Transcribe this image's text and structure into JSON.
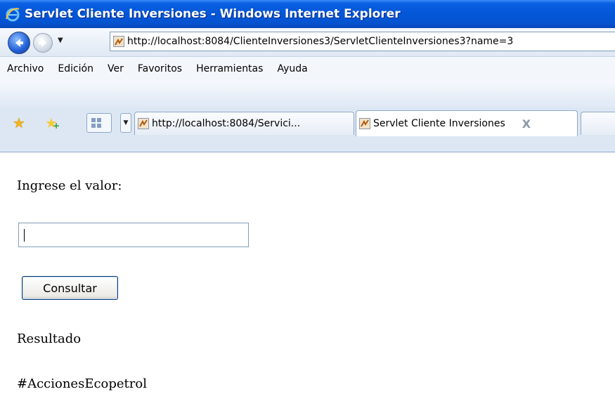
{
  "window": {
    "title": "Servlet Cliente Inversiones - Windows Internet Explorer"
  },
  "nav": {
    "back_icon": "back-arrow-icon",
    "forward_icon": "forward-arrow-icon",
    "dropdown_glyph": "▼",
    "address": "http://localhost:8084/ClienteInversiones3/ServletClienteInversiones3?name=3"
  },
  "menu": {
    "items": [
      "Archivo",
      "Edición",
      "Ver",
      "Favoritos",
      "Herramientas",
      "Ayuda"
    ]
  },
  "tabs": {
    "items": [
      {
        "label": "http://localhost:8084/Servici..."
      },
      {
        "label": "Servlet Cliente Inversiones",
        "active": true,
        "close": "X"
      }
    ]
  },
  "page": {
    "prompt": "Ingrese el valor:",
    "input_value": "",
    "button_label": "Consultar",
    "result_label": "Resultado",
    "result_value": "#AccionesEcopetrol"
  },
  "colors": {
    "title_bar": "#0356d6",
    "page_bg": "#ffffff"
  }
}
